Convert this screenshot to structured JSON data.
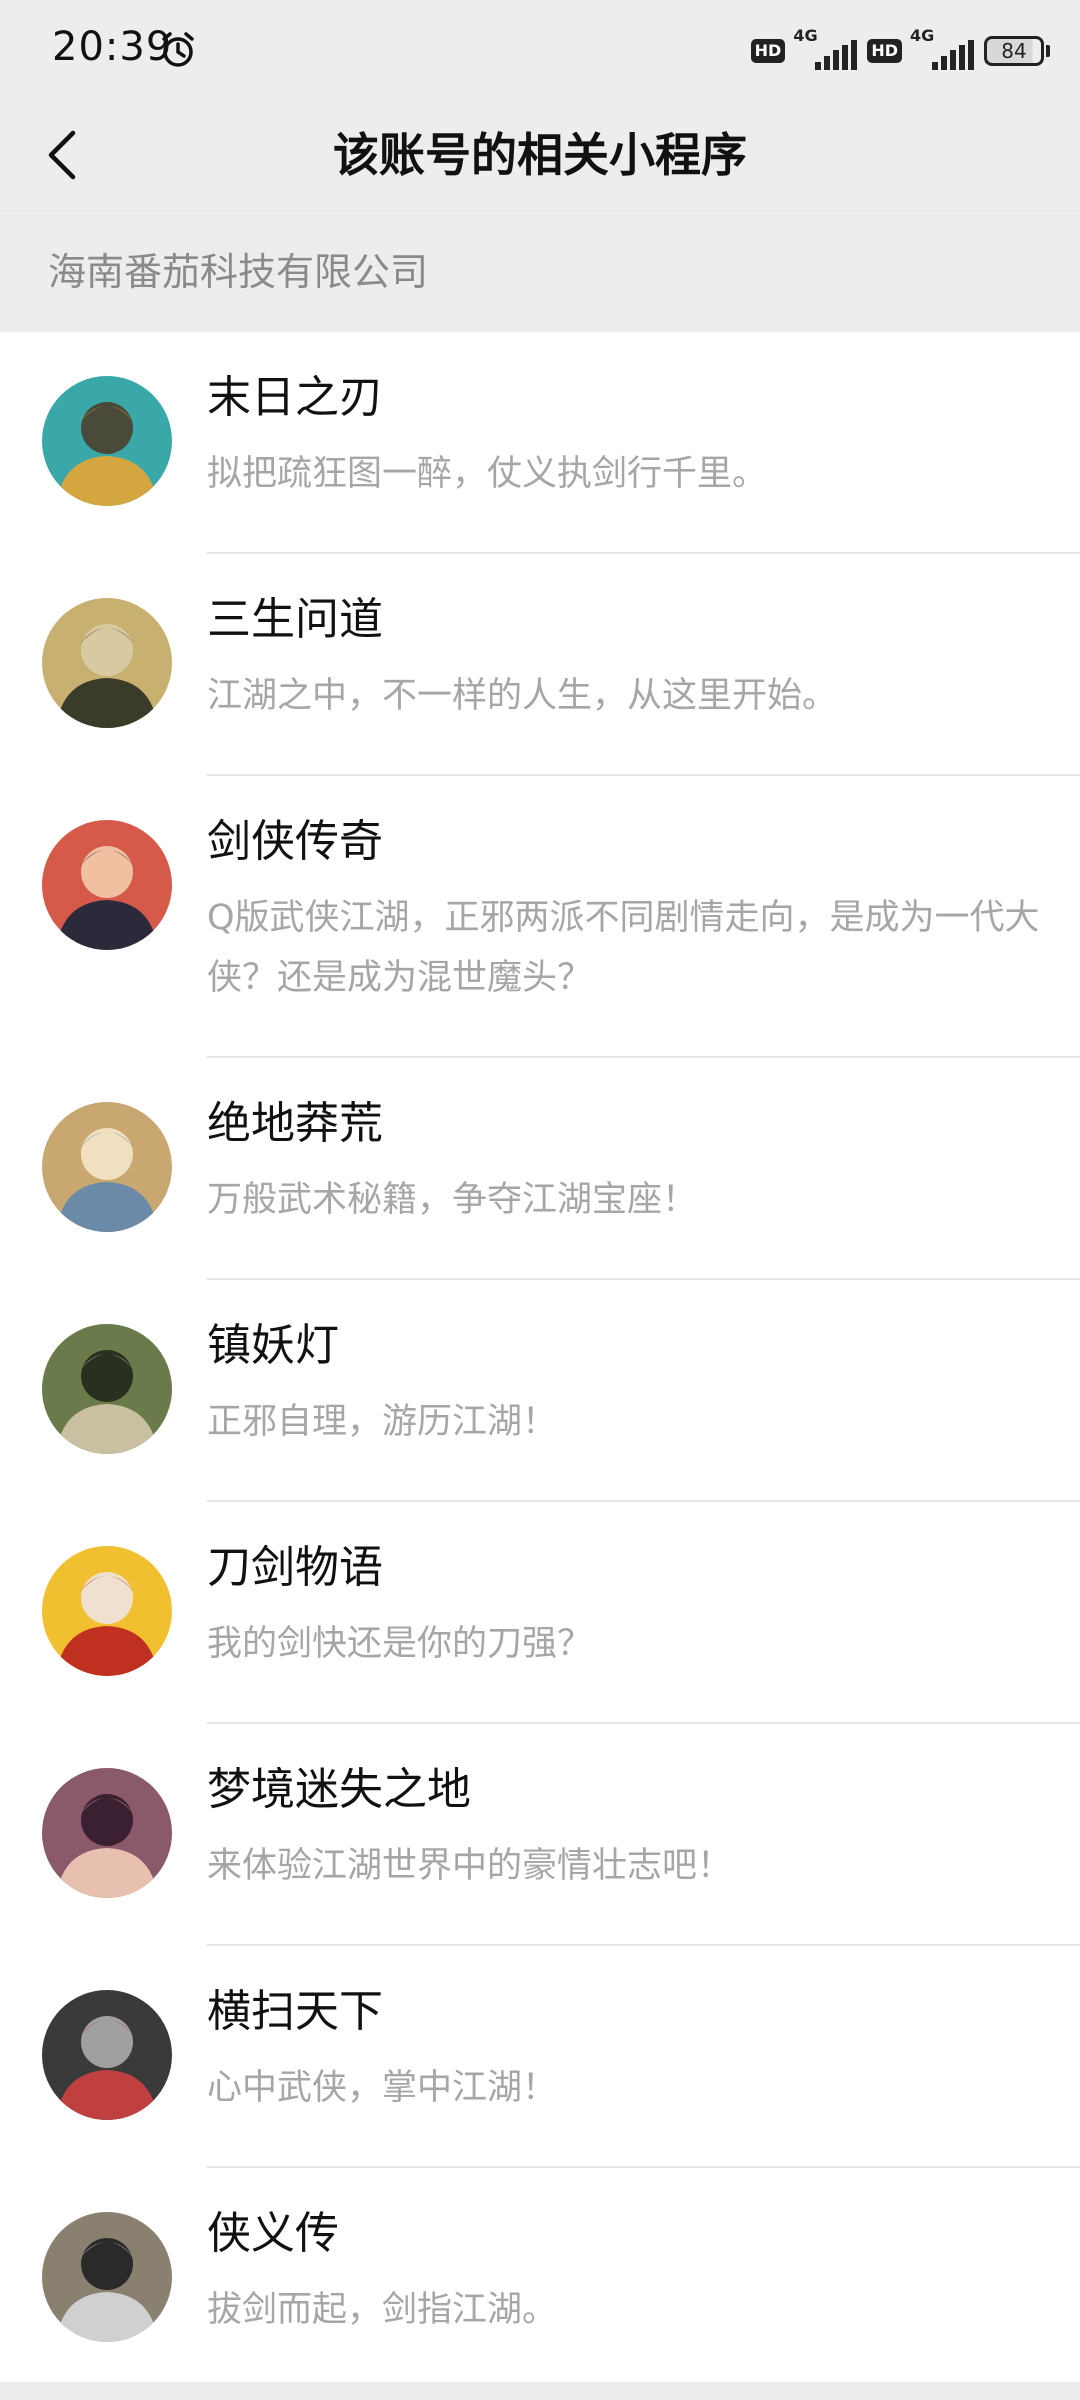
{
  "status_bar": {
    "time": "20:39",
    "hd1": "HD",
    "net1": "4G",
    "hd2": "HD",
    "net2": "4G",
    "battery": "84"
  },
  "nav": {
    "title": "该账号的相关小程序"
  },
  "section": {
    "title": "海南番茄科技有限公司"
  },
  "items": [
    {
      "name": "末日之刃",
      "desc": "拟把疏狂图一醉，仗义执剑行千里。",
      "colors": [
        "#3aa8a8",
        "#d4a640",
        "#4a4a3a"
      ]
    },
    {
      "name": "三生问道",
      "desc": "江湖之中，不一样的人生，从这里开始。",
      "colors": [
        "#c8b070",
        "#3b3b2a",
        "#d9c9a0"
      ]
    },
    {
      "name": "剑侠传奇",
      "desc": "Q版武侠江湖，正邪两派不同剧情走向，是成为一代大侠？还是成为混世魔头？",
      "colors": [
        "#d65a4a",
        "#2a2a3a",
        "#f0c0a0"
      ]
    },
    {
      "name": "绝地莽荒",
      "desc": "万般武术秘籍，争夺江湖宝座！",
      "colors": [
        "#c8a870",
        "#6a8aa8",
        "#f0e0c0"
      ]
    },
    {
      "name": "镇妖灯",
      "desc": "正邪自理，游历江湖！",
      "colors": [
        "#6a7a4a",
        "#c8c0a0",
        "#2a3020"
      ]
    },
    {
      "name": "刀剑物语",
      "desc": "我的剑快还是你的刀强？",
      "colors": [
        "#f0c030",
        "#c03020",
        "#f0e0d0"
      ]
    },
    {
      "name": "梦境迷失之地",
      "desc": "来体验江湖世界中的豪情壮志吧！",
      "colors": [
        "#8a5a6a",
        "#e8c0b0",
        "#3a2030"
      ]
    },
    {
      "name": "横扫天下",
      "desc": "心中武侠，掌中江湖！",
      "colors": [
        "#3a3a3a",
        "#c04040",
        "#a0a0a0"
      ]
    },
    {
      "name": "侠义传",
      "desc": "拔剑而起，剑指江湖。",
      "colors": [
        "#8a8070",
        "#d0d0d0",
        "#2a2a2a"
      ]
    }
  ]
}
